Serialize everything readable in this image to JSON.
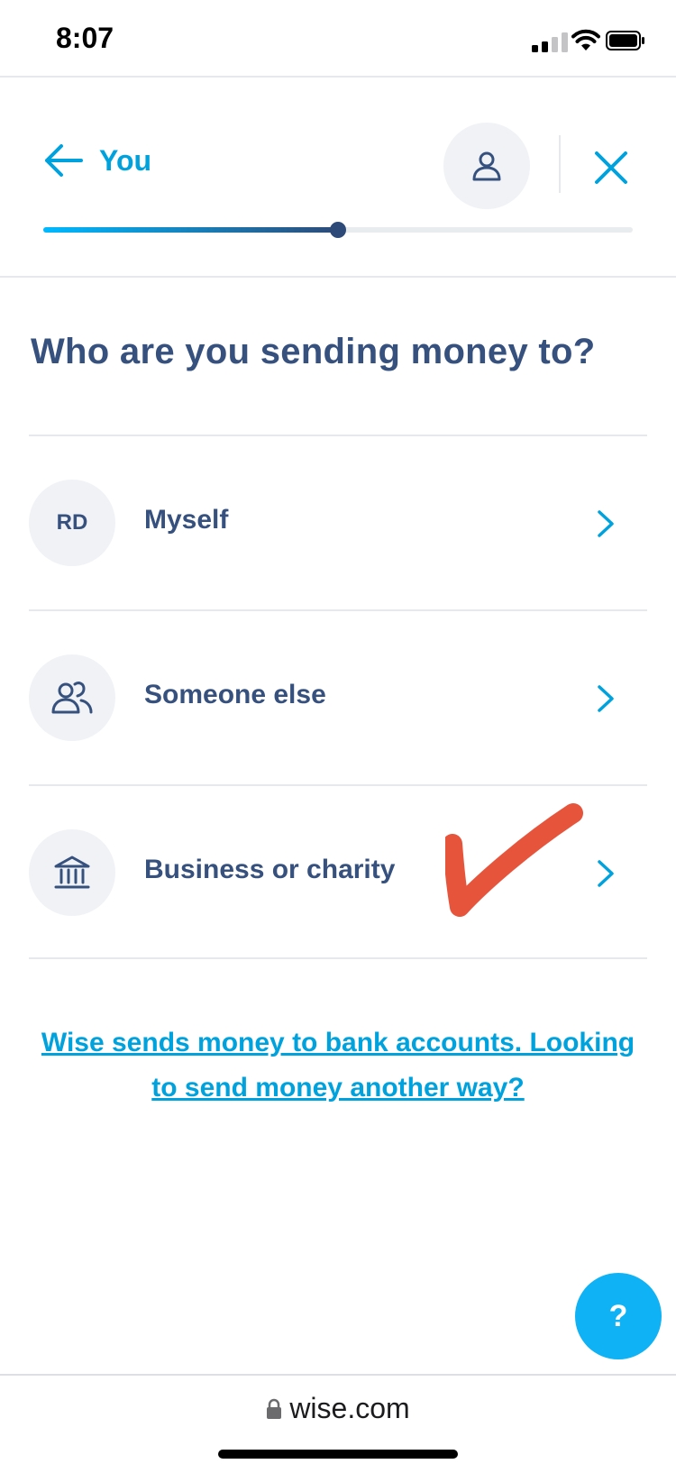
{
  "status_bar": {
    "time": "8:07"
  },
  "header": {
    "back_label": "You",
    "progress": 0.5
  },
  "title": "Who are you sending money to?",
  "options": [
    {
      "avatar_text": "RD",
      "label": "Myself"
    },
    {
      "icon": "people-icon",
      "label": "Someone else"
    },
    {
      "icon": "bank-icon",
      "label": "Business or charity"
    }
  ],
  "info_link": "Wise sends money to bank accounts. Looking to send money another way?",
  "help_label": "?",
  "browser": {
    "url": "wise.com"
  },
  "colors": {
    "accent": "#00a2dd",
    "text": "#37517e",
    "help_button": "#0fb2f5",
    "checkmark": "#e5452b"
  }
}
